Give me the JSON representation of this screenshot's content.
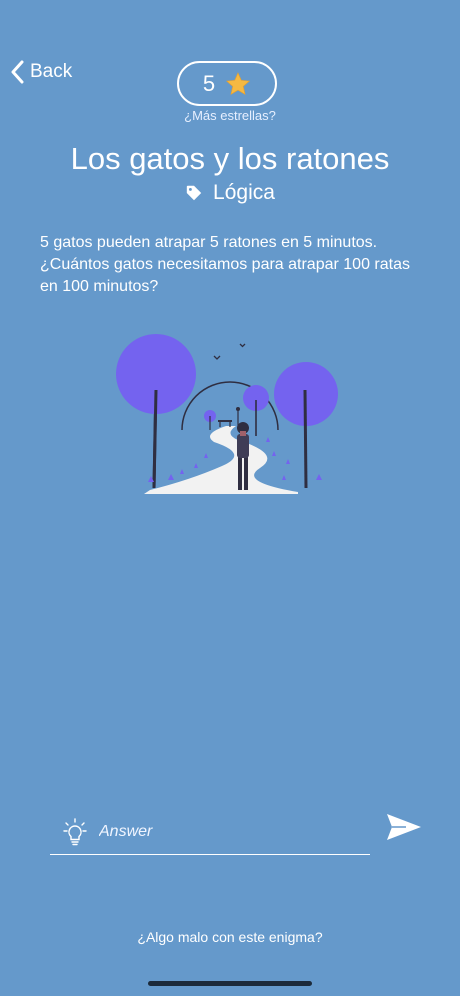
{
  "nav": {
    "back_label": "Back"
  },
  "stars": {
    "count": "5",
    "more_label": "¿Más estrellas?"
  },
  "riddle": {
    "title": "Los gatos y los ratones",
    "category": "Lógica",
    "question": "5 gatos pueden atrapar 5 ratones en 5 minutos. ¿Cuántos gatos necesitamos para atrapar 100 ratas en 100 minutos?"
  },
  "answer": {
    "placeholder": "Answer"
  },
  "footer": {
    "report_label": "¿Algo malo con este enigma?"
  },
  "colors": {
    "background": "#6599CB",
    "accent_purple": "#7463EF",
    "star": "#F5B942",
    "text": "#FFFFFF"
  }
}
